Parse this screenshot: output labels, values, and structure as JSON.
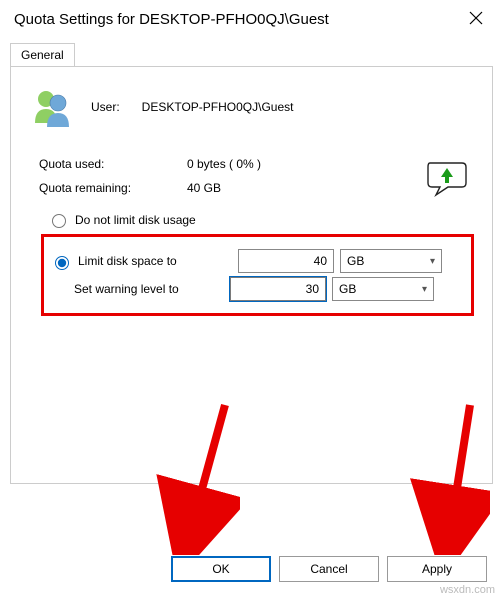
{
  "title": "Quota Settings for DESKTOP-PFHO0QJ\\Guest",
  "tab": {
    "general": "General"
  },
  "user": {
    "label": "User:",
    "value": "DESKTOP-PFHO0QJ\\Guest"
  },
  "quota": {
    "used_label": "Quota used:",
    "used_value": "0 bytes ( 0% )",
    "remaining_label": "Quota remaining:",
    "remaining_value": "40 GB"
  },
  "options": {
    "no_limit": "Do not limit disk usage",
    "limit": "Limit disk space to",
    "warning": "Set warning level to",
    "limit_value": "40",
    "limit_unit": "GB",
    "warning_value": "30",
    "warning_unit": "GB"
  },
  "buttons": {
    "ok": "OK",
    "cancel": "Cancel",
    "apply": "Apply"
  },
  "watermark": "wsxdn.com"
}
